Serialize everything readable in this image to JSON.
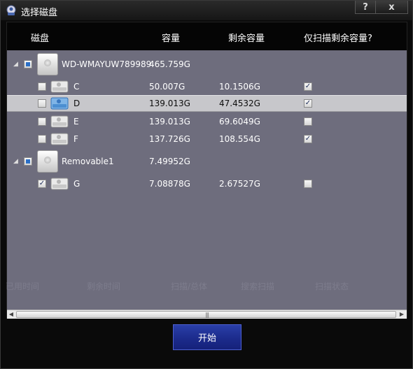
{
  "window": {
    "title": "选择磁盘",
    "help_label": "?",
    "close_label": "x"
  },
  "columns": {
    "disk": "磁盘",
    "capacity": "容量",
    "free": "剩余容量",
    "scan_free_only": "仅扫描剩余容量?"
  },
  "disks": [
    {
      "name": "WD-WMAYUW789989",
      "capacity": "465.759G",
      "partitions": [
        {
          "letter": "C",
          "capacity": "50.007G",
          "free": "10.1506G",
          "selected": false,
          "checked": false,
          "scan_free": true
        },
        {
          "letter": "D",
          "capacity": "139.013G",
          "free": "47.4532G",
          "selected": true,
          "checked": false,
          "scan_free": true
        },
        {
          "letter": "E",
          "capacity": "139.013G",
          "free": "69.6049G",
          "selected": false,
          "checked": false,
          "scan_free": false
        },
        {
          "letter": "F",
          "capacity": "137.726G",
          "free": "108.554G",
          "selected": false,
          "checked": false,
          "scan_free": true
        }
      ]
    },
    {
      "name": "Removable1",
      "capacity": "7.49952G",
      "partitions": [
        {
          "letter": "G",
          "capacity": "7.08878G",
          "free": "2.67527G",
          "selected": false,
          "checked": true,
          "scan_free": false
        }
      ]
    }
  ],
  "check_mark": "✓",
  "expander_glyph": "◢",
  "background_columns": [
    "已用时间",
    "剩余时间",
    "扫描/总体",
    "搜索扫描",
    "扫描状态"
  ],
  "scrollbar": {
    "left_arrow": "◀",
    "right_arrow": "▶",
    "grip": "|||"
  },
  "start_button": "开始",
  "colors": {
    "panel": "#6e6d7d",
    "header": "#050505",
    "selected_row": "#c7c7cb",
    "start_button": "#1c2b8c",
    "partial_check": "#2a6fc6"
  }
}
